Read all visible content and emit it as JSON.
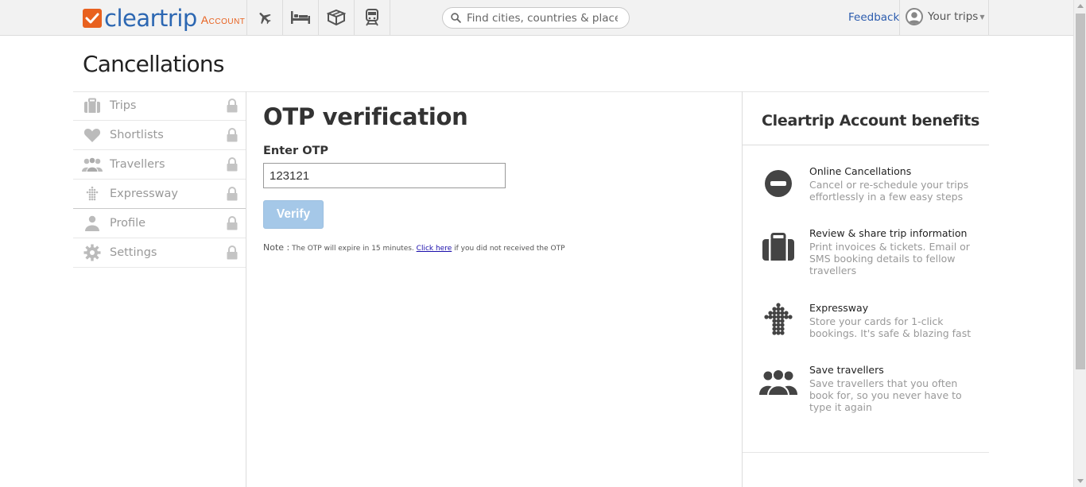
{
  "header": {
    "logo_word": "cleartrip",
    "logo_sub": "Account",
    "nav_icons": [
      "plane-icon",
      "bed-icon",
      "box-icon",
      "train-icon"
    ],
    "search_placeholder": "Find cities, countries & places",
    "feedback": "Feedback",
    "your_trips": "Your trips",
    "brand_color": "#e8611f",
    "link_color": "#2c67b2"
  },
  "page": {
    "title": "Cancellations"
  },
  "sidebar": {
    "items": [
      {
        "label": "Trips",
        "icon": "briefcase-icon",
        "locked": true
      },
      {
        "label": "Shortlists",
        "icon": "heart-icon",
        "locked": true
      },
      {
        "label": "Travellers",
        "icon": "travellers-icon",
        "locked": true
      },
      {
        "label": "Expressway",
        "icon": "expressway-icon",
        "locked": true
      },
      {
        "label": "Profile",
        "icon": "profile-icon",
        "locked": true
      },
      {
        "label": "Settings",
        "icon": "gear-icon",
        "locked": true
      }
    ]
  },
  "main": {
    "title": "OTP verification",
    "input_label": "Enter OTP",
    "otp_value": "123121",
    "verify_label": "Verify",
    "note_head": "Note :",
    "note_text_1": " The OTP will expire in 15 minutes. ",
    "note_link": "Click here",
    "note_text_2": " if you did not received the OTP"
  },
  "benefits": {
    "title": "Cleartrip Account benefits",
    "items": [
      {
        "icon": "minus-circle-icon",
        "head": "Online Cancellations",
        "desc": "Cancel or re-schedule your trips effortlessly in a few easy steps"
      },
      {
        "icon": "briefcase-icon",
        "head": "Review & share trip information",
        "desc": "Print invoices & tickets. Email or SMS booking details to fellow travellers"
      },
      {
        "icon": "expressway-icon",
        "head": "Expressway",
        "desc": "Store your cards for 1-click bookings. It's safe & blazing fast"
      },
      {
        "icon": "travellers-icon",
        "head": "Save travellers",
        "desc": "Save travellers that you often book for, so you never have to type it again"
      }
    ]
  }
}
